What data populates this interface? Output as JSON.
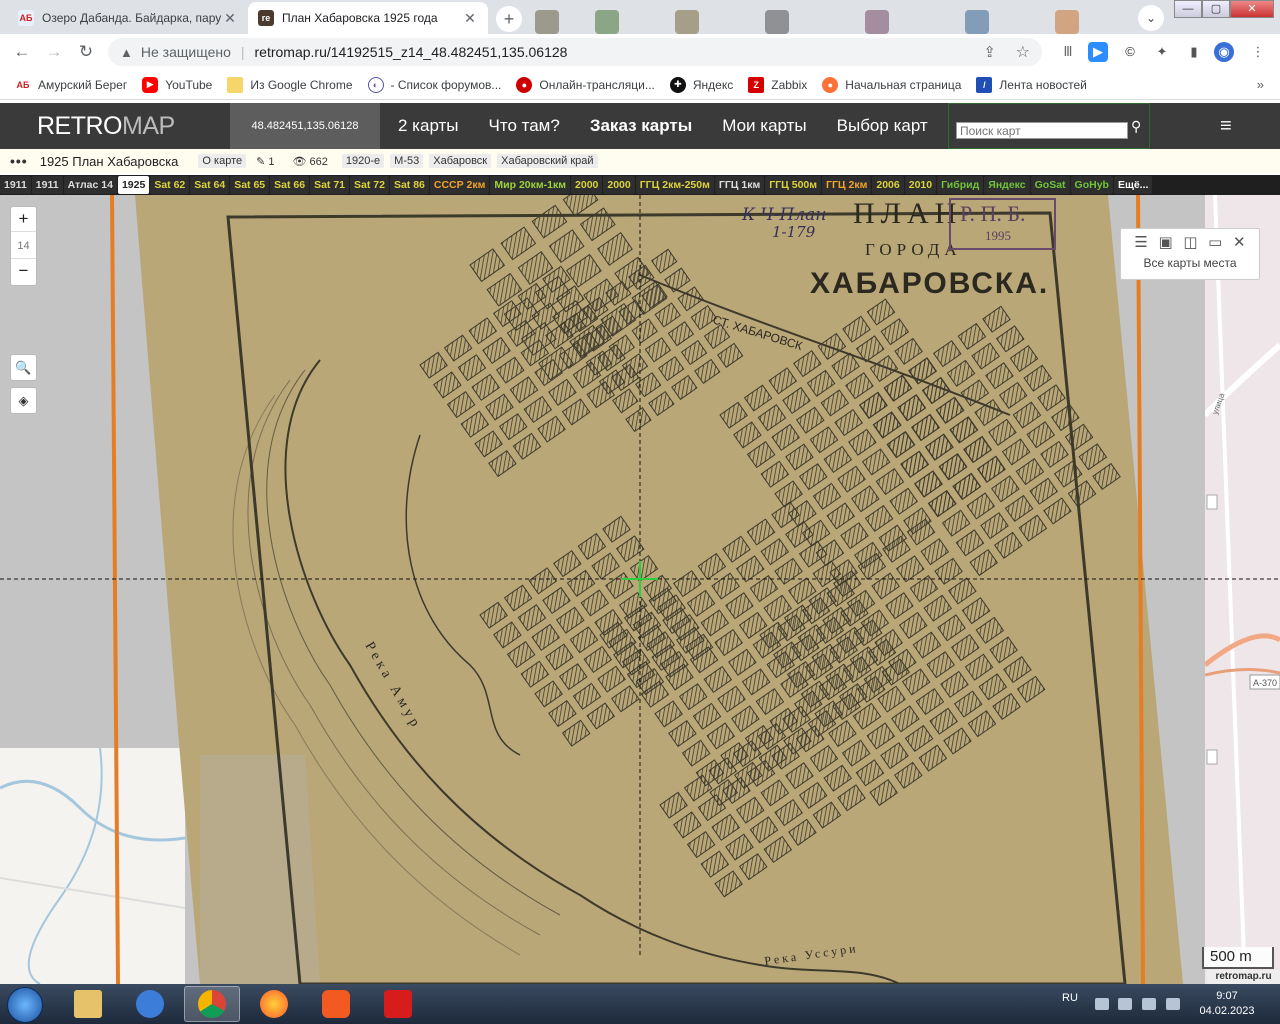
{
  "browser": {
    "tabs": [
      {
        "title": "Озеро Дабанда. Байдарка, пару",
        "favicon_text": "AБ",
        "favicon_color": "#e8f0fe",
        "favicon_fg": "#c22",
        "close": "✕"
      },
      {
        "title": "План Хабаровска 1925 года",
        "favicon_text": "re",
        "favicon_color": "#4b3b2e",
        "favicon_fg": "#fff",
        "close": "✕"
      }
    ],
    "new_tab": "+",
    "tab_search": "⌄",
    "window_controls": {
      "minimize": "—",
      "maximize": "▢",
      "close": "✕"
    },
    "nav": {
      "back": "←",
      "forward": "→",
      "reload": "↻"
    },
    "security_label": "Не защищено",
    "url": "retromap.ru/14192515_z14_48.482451,135.06128",
    "bookmarks": [
      {
        "label": "Амурский Берег",
        "icon": "amur-icon",
        "color": "#fff",
        "fg": "#c22",
        "glyph": "AБ"
      },
      {
        "label": "YouTube",
        "icon": "youtube-icon",
        "color": "#f00",
        "fg": "#fff",
        "glyph": "▶"
      },
      {
        "label": "Из Google Chrome",
        "icon": "folder-icon",
        "color": "#f6d66b",
        "fg": "#f6d66b",
        "glyph": ""
      },
      {
        "label": "- Список форумов...",
        "icon": "forum-icon",
        "color": "#fff",
        "fg": "#55a",
        "glyph": "◐"
      },
      {
        "label": "Онлайн-трансляци...",
        "icon": "stream-icon",
        "color": "#c00",
        "fg": "#fff",
        "glyph": "●"
      },
      {
        "label": "Яндекс",
        "icon": "yandex-icon",
        "color": "#111",
        "fg": "#fff",
        "glyph": "✚"
      },
      {
        "label": "Zabbix",
        "icon": "zabbix-icon",
        "color": "#d40000",
        "fg": "#fff",
        "glyph": "Z"
      },
      {
        "label": "Начальная страница",
        "icon": "firefox-icon",
        "color": "#ff7139",
        "fg": "#fff",
        "glyph": "●"
      },
      {
        "label": "Лента новостей",
        "icon": "news-icon",
        "color": "#1f4fb5",
        "fg": "#fff",
        "glyph": "/"
      }
    ],
    "bookmarks_more": "»"
  },
  "site": {
    "logo_retro": "RETRO",
    "logo_map": "MAP",
    "coords": "48.482451,135.06128",
    "menu": [
      "2 карты",
      "Что там?",
      "Заказ карты",
      "Мои карты",
      "Выбор карт"
    ],
    "menu_bold_index": 2,
    "search_placeholder": "Поиск карт",
    "burger": "≡"
  },
  "map_title": {
    "dots": "•••",
    "name": "1925 План Хабаровска",
    "about": "О карте",
    "edits": "1",
    "views": "662",
    "tags": [
      "1920-е",
      "М-53",
      "Хабаровск",
      "Хабаровский край"
    ]
  },
  "layers": [
    {
      "label": "1911",
      "color": "default"
    },
    {
      "label": "1911",
      "color": "default"
    },
    {
      "label": "Атлас 14",
      "color": "default"
    },
    {
      "label": "1925",
      "color": "active"
    },
    {
      "label": "Sat 62",
      "color": "yellow"
    },
    {
      "label": "Sat 64",
      "color": "yellow"
    },
    {
      "label": "Sat 65",
      "color": "yellow"
    },
    {
      "label": "Sat 66",
      "color": "yellow"
    },
    {
      "label": "Sat 71",
      "color": "yellow"
    },
    {
      "label": "Sat 72",
      "color": "yellow"
    },
    {
      "label": "Sat 86",
      "color": "yellow"
    },
    {
      "label": "СССР 2км",
      "color": "orange"
    },
    {
      "label": "Мир 20км-1км",
      "color": "lime"
    },
    {
      "label": "2000",
      "color": "yellow"
    },
    {
      "label": "2000",
      "color": "yellow"
    },
    {
      "label": "ГГЦ 2км-250м",
      "color": "yellow"
    },
    {
      "label": "ГГЦ 1км",
      "color": "default"
    },
    {
      "label": "ГГЦ 500м",
      "color": "yellow"
    },
    {
      "label": "ГГЦ 2км",
      "color": "orange"
    },
    {
      "label": "2006",
      "color": "yellow"
    },
    {
      "label": "2010",
      "color": "yellow"
    },
    {
      "label": "Гибрид",
      "color": "green"
    },
    {
      "label": "Яндекс",
      "color": "green"
    },
    {
      "label": "GoSat",
      "color": "green"
    },
    {
      "label": "GoHyb",
      "color": "green"
    },
    {
      "label": "Ещё...",
      "color": "more"
    }
  ],
  "map": {
    "zoom_in": "+",
    "zoom_level": "14",
    "zoom_out": "−",
    "title_plan": "ПЛАН",
    "title_city_of": "ГОРОДА",
    "title_city": "ХАБАРОВСКА.",
    "stamp_text": "Р. П. Б.",
    "stamp_year": "1995",
    "handwriting_1": "К Ч-План",
    "handwriting_2": "1-179",
    "station_label": "СТ. ХАБАРОВСК",
    "river_label_1": "Река Амур",
    "river_label_2": "Река Уссури",
    "panel_label": "Все карты места",
    "scale": "500 m",
    "attribution": "retromap.ru",
    "paper_color": "#b9a778",
    "ink_color": "#3d3a2c"
  },
  "taskbar": {
    "lang": "RU",
    "time": "9:07",
    "date": "04.02.2023",
    "apps": [
      "explorer",
      "mail",
      "chrome",
      "firefox",
      "brave",
      "acrobat"
    ]
  }
}
